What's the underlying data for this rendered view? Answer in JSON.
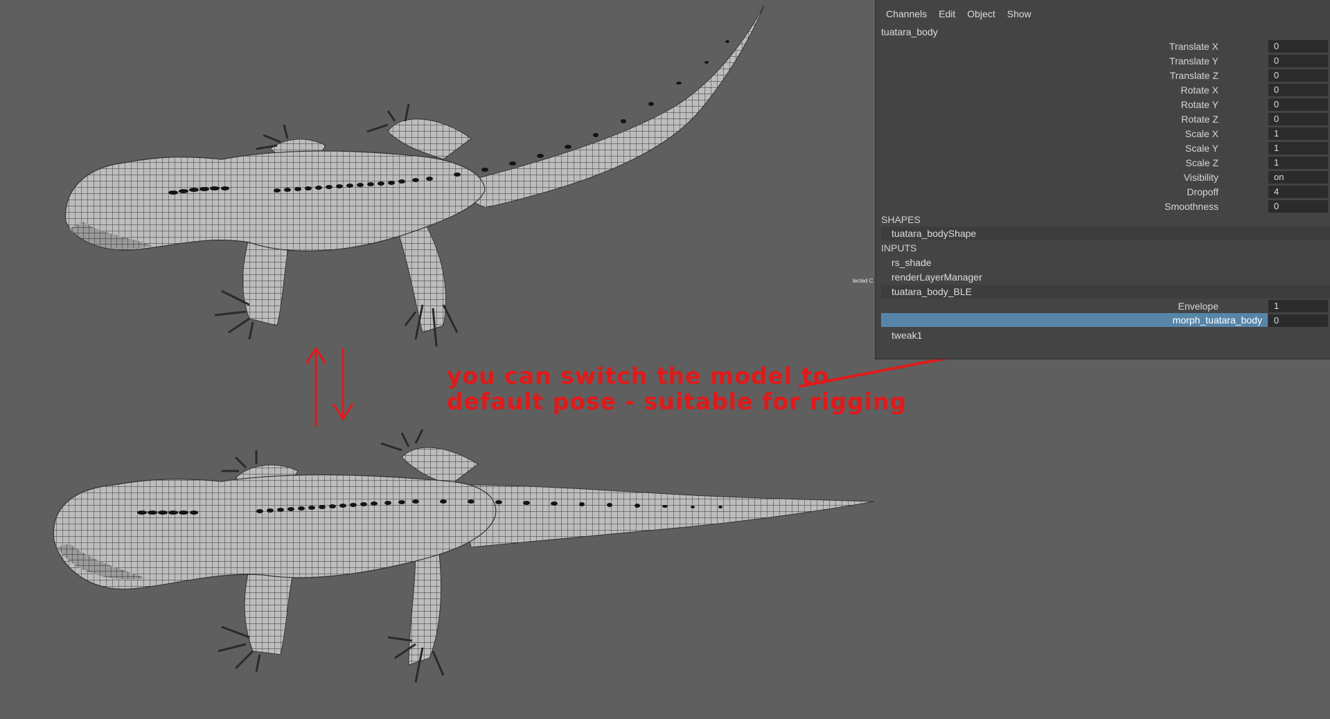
{
  "channel_box": {
    "menu": [
      "Channels",
      "Edit",
      "Object",
      "Show"
    ],
    "node_name": "tuatara_body",
    "attributes": [
      {
        "label": "Translate X",
        "value": "0"
      },
      {
        "label": "Translate Y",
        "value": "0"
      },
      {
        "label": "Translate Z",
        "value": "0"
      },
      {
        "label": "Rotate X",
        "value": "0"
      },
      {
        "label": "Rotate Y",
        "value": "0"
      },
      {
        "label": "Rotate Z",
        "value": "0"
      },
      {
        "label": "Scale X",
        "value": "1"
      },
      {
        "label": "Scale Y",
        "value": "1"
      },
      {
        "label": "Scale Z",
        "value": "1"
      },
      {
        "label": "Visibility",
        "value": "on"
      },
      {
        "label": "Dropoff",
        "value": "4"
      },
      {
        "label": "Smoothness",
        "value": "0"
      }
    ],
    "shapes_header": "SHAPES",
    "shapes": [
      "tuatara_bodyShape"
    ],
    "inputs_header": "INPUTS",
    "inputs": [
      "rs_shade",
      "renderLayerManager",
      "tuatara_body_BLE"
    ],
    "blend_attributes": [
      {
        "label": "Envelope",
        "value": "1"
      },
      {
        "label": "morph_tuatara_body",
        "value": "0"
      }
    ],
    "extra_inputs": [
      "tweak1"
    ]
  },
  "viewport": {
    "clipped_label": "lected C"
  },
  "annotation": {
    "line1": "you can switch the model to",
    "line2": "default pose - suitable for rigging",
    "color": "#e01a1a"
  },
  "colors": {
    "viewport_bg": "#5f5f5f",
    "panel_bg": "#444444",
    "selection": "#5685a8"
  }
}
